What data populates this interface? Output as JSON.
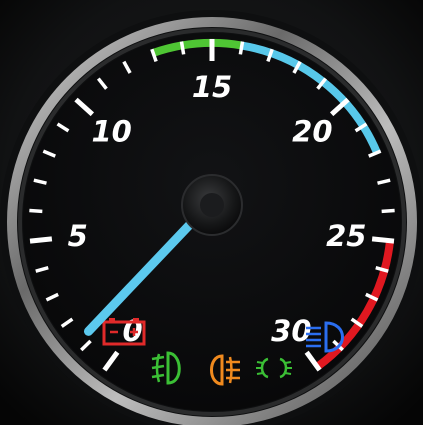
{
  "gauge": {
    "min": 0,
    "max": 30,
    "labels": [
      "0",
      "5",
      "10",
      "15",
      "20",
      "25",
      "30"
    ],
    "needle_value": 1.3,
    "bands": [
      {
        "name": "green",
        "from": 13,
        "to": 16,
        "color": "#4fc634"
      },
      {
        "name": "blue",
        "from": 16,
        "to": 22,
        "color": "#58c8ea"
      },
      {
        "name": "red",
        "from": 25,
        "to": 30,
        "color": "#e01820"
      }
    ],
    "needle_color": "#5cc9ee",
    "tick_color": "#ffffff"
  },
  "indicators": [
    {
      "name": "battery-icon",
      "color": "#e02a2a"
    },
    {
      "name": "front-fog-light-icon",
      "color": "#3bbf35"
    },
    {
      "name": "rear-fog-light-icon",
      "color": "#f08a1e"
    },
    {
      "name": "position-light-icon",
      "color": "#3bbf35"
    },
    {
      "name": "high-beam-icon",
      "color": "#2b6ef0"
    }
  ]
}
